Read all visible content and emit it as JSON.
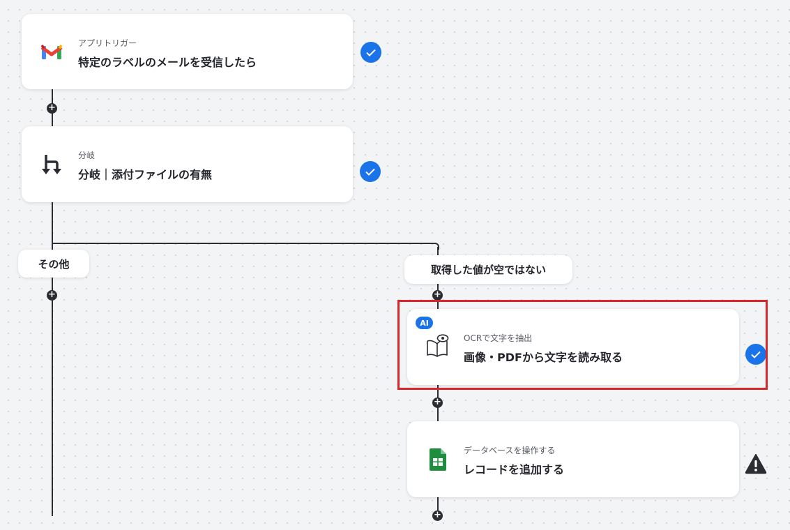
{
  "nodes": [
    {
      "sub": "アプリトリガー",
      "title": "特定のラベルのメールを受信したら",
      "icon": "gmail-icon",
      "status": "done"
    },
    {
      "sub": "分岐",
      "title": "分岐｜添付ファイルの有無",
      "icon": "branch-icon",
      "status": "done"
    },
    {
      "sub": "OCRで文字を抽出",
      "title": "画像・PDFから文字を読み取る",
      "icon": "ocr-book-icon",
      "badge": "AI",
      "status": "done"
    },
    {
      "sub": "データベースを操作する",
      "title": "レコードを追加する",
      "icon": "google-sheets-icon",
      "status": "warning"
    }
  ],
  "branches": {
    "left_label": "その他",
    "right_label": "取得した値が空ではない"
  },
  "colors": {
    "accent": "#1a73e8",
    "highlight": "#d9262a",
    "line": "#2b2d33",
    "sheets_green": "#1e8e3e"
  }
}
